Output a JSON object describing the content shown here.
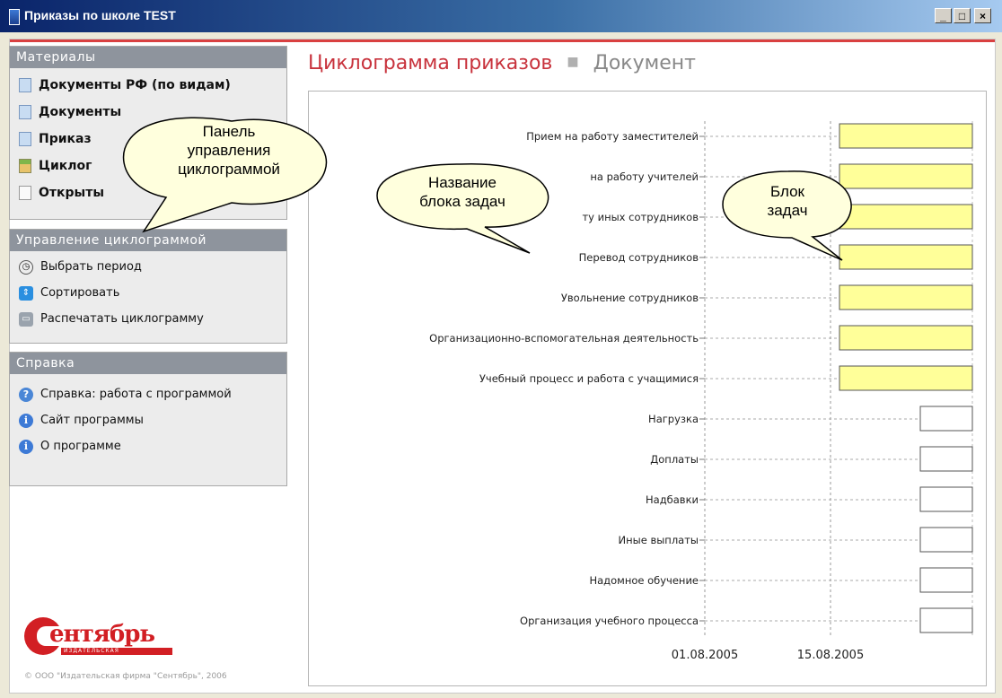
{
  "window": {
    "title": "Приказы по школе TEST",
    "buttons": {
      "minimize": "_",
      "maximize": "□",
      "close": "×"
    }
  },
  "sidebar": {
    "materials": {
      "title": "Материалы",
      "items": [
        {
          "label": "Документы РФ (по видам)",
          "icon": "document-icon"
        },
        {
          "label": "Документы ",
          "icon": "document-icon"
        },
        {
          "label": "Приказ",
          "icon": "document-icon"
        },
        {
          "label": "Циклог",
          "icon": "cyclogram-icon"
        },
        {
          "label": "Открыты",
          "icon": "blank-document-icon"
        }
      ]
    },
    "control": {
      "title": "Управление циклограммой",
      "items": [
        {
          "label": "Выбрать период",
          "icon": "clock-icon"
        },
        {
          "label": "Сортировать",
          "icon": "sort-icon"
        },
        {
          "label": "Распечатать циклограмму",
          "icon": "printer-icon"
        }
      ]
    },
    "help": {
      "title": "Справка",
      "items": [
        {
          "label": "Справка: работа с программой",
          "icon": "help-icon"
        },
        {
          "label": "Сайт программы",
          "icon": "info-icon"
        },
        {
          "label": "О программе",
          "icon": "info-icon"
        }
      ]
    },
    "logo_text": "ентябрь",
    "logo_subtext": "ИЗДАТЕЛЬСКАЯ ФИРМА",
    "copyright": "© ООО \"Издательская фирма \"Сентябрь\", 2006"
  },
  "main": {
    "title": "Циклограмма приказов",
    "separator": "■",
    "subtitle": "Документ"
  },
  "chart_data": {
    "type": "gantt",
    "categories": [
      "Прием на работу заместителей",
      "Прием на работу учителей",
      "Прием на работу иных сотрудников",
      "Перевод сотрудников",
      "Увольнение сотрудников",
      "Организационно-вспомогательная деятельность",
      "Учебный процесс и работа с учащимися",
      "Нагрузка",
      "Доплаты",
      "Надбавки",
      "Иные выплаты",
      "Надомное обучение",
      "Организация учебного процесса"
    ],
    "displayed_labels": [
      "Прием на работу заместителей",
      "на работу учителей",
      "ту иных сотрудников",
      "Перевод сотрудников",
      "Увольнение сотрудников",
      "Организационно-вспомогательная деятельность",
      "Учебный процесс и работа с учащимися",
      "Нагрузка",
      "Доплаты",
      "Надбавки",
      "Иные выплаты",
      "Надомное обучение",
      "Организация учебного процесса"
    ],
    "x_ticks": [
      "01.08.2005",
      "15.08.2005"
    ],
    "bar_starts_days_after_axis_start": [
      15,
      15,
      15,
      15,
      15,
      15,
      15,
      24,
      24,
      24,
      24,
      24,
      24
    ],
    "bar_colors": [
      "#ffff99",
      "#ffff99",
      "#ffff99",
      "#ffff99",
      "#ffff99",
      "#ffff99",
      "#ffff99",
      "#ffffff",
      "#ffffff",
      "#ffffff",
      "#ffffff",
      "#ffffff",
      "#ffffff"
    ],
    "grid": "dashed"
  },
  "callouts": [
    {
      "text": "Панель\nуправления\nциклограммой"
    },
    {
      "text": "Название\nблока задач"
    },
    {
      "text": "Блок\nзадач"
    }
  ]
}
